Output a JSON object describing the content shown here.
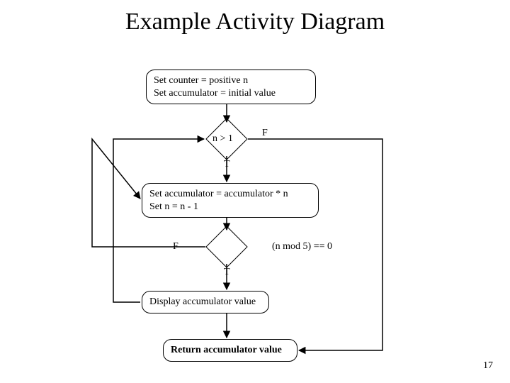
{
  "title": "Example Activity Diagram",
  "box_init_line1": "Set counter = positive n",
  "box_init_line2": "Set accumulator = initial value",
  "dec1_label": "n > 1",
  "dec1_true": "T",
  "dec1_false": "F",
  "box_loop_line1": "Set accumulator = accumulator * n",
  "box_loop_line2": "Set n = n - 1",
  "dec2_true": "T",
  "dec2_false": "F",
  "dec2_cond": "(n mod 5) == 0",
  "box_display": "Display accumulator value",
  "box_return": "Return accumulator value",
  "page_number": "17"
}
